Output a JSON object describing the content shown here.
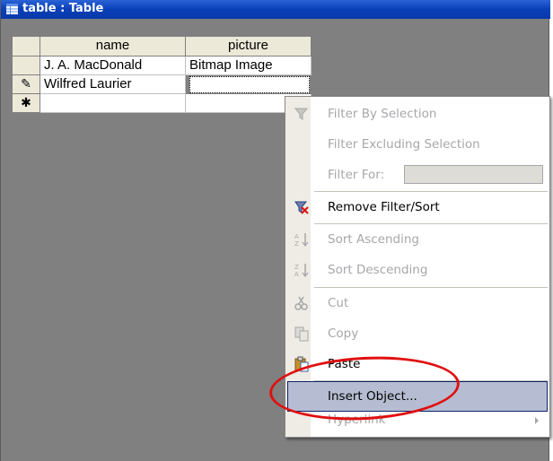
{
  "window": {
    "title": "table : Table"
  },
  "table": {
    "columns": [
      "name",
      "picture"
    ],
    "rows": [
      {
        "selector": "",
        "name": "J. A. MacDonald",
        "picture": "Bitmap Image"
      },
      {
        "selector": "✎",
        "name": "Wilfred Laurier",
        "picture": ""
      },
      {
        "selector": "✱",
        "name": "",
        "picture": ""
      }
    ]
  },
  "menu": {
    "items": [
      {
        "label": "Filter By Selection",
        "icon": "filter-by-selection-icon",
        "enabled": false
      },
      {
        "label": "Filter Excluding Selection",
        "icon": "",
        "enabled": false
      },
      {
        "label": "Filter For:",
        "icon": "",
        "enabled": false
      },
      {
        "label": "Remove Filter/Sort",
        "icon": "remove-filter-icon",
        "enabled": true
      },
      {
        "label": "Sort Ascending",
        "icon": "sort-ascending-icon",
        "enabled": false
      },
      {
        "label": "Sort Descending",
        "icon": "sort-descending-icon",
        "enabled": false
      },
      {
        "label": "Cut",
        "icon": "cut-icon",
        "enabled": false
      },
      {
        "label": "Copy",
        "icon": "copy-icon",
        "enabled": false
      },
      {
        "label": "Paste",
        "icon": "paste-icon",
        "enabled": true
      },
      {
        "label": "Insert Object...",
        "icon": "",
        "enabled": true,
        "highlighted": true
      },
      {
        "label": "Hyperlink",
        "icon": "",
        "enabled": false,
        "submenu": true
      }
    ]
  },
  "colors": {
    "titlebar": "#0a3fb8",
    "highlight": "#b6bdd2",
    "annotation": "#e01010"
  }
}
